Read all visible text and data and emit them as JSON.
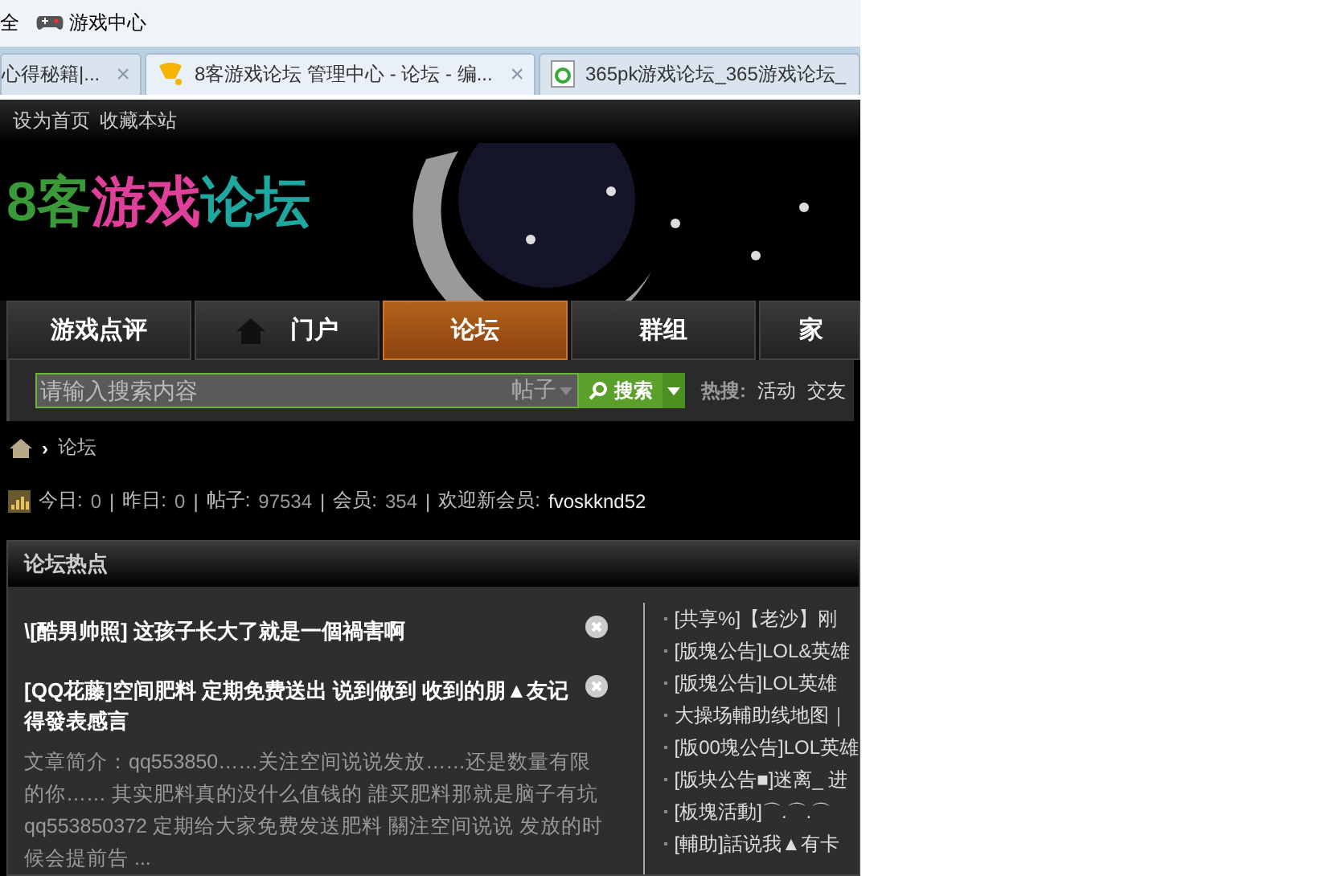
{
  "bookmarks": [
    {
      "label": "全",
      "kind": "text"
    },
    {
      "label": "游戏中心",
      "kind": "game"
    }
  ],
  "tabs": [
    {
      "label": "心得秘籍|...",
      "selected": false,
      "kind": "plain",
      "close": "×"
    },
    {
      "label": "8客游戏论坛 管理中心 - 论坛 - 编...",
      "selected": true,
      "kind": "forum",
      "close": "×"
    },
    {
      "label": "365pk游戏论坛_365游戏论坛_",
      "selected": false,
      "kind": "page"
    }
  ],
  "top_links": [
    "设为首页",
    "收藏本站"
  ],
  "logo": [
    {
      "text": "8客",
      "color": "#3a9a3a"
    },
    {
      "text": "游戏",
      "color": "#e0409a"
    },
    {
      "text": "论坛",
      "color": "#1fa8a0"
    }
  ],
  "nav": [
    {
      "label": "游戏点评",
      "selected": false,
      "icon": false
    },
    {
      "label": "门户",
      "selected": false,
      "icon": true
    },
    {
      "label": "论坛",
      "selected": true,
      "icon": false
    },
    {
      "label": "群组",
      "selected": false,
      "icon": false
    },
    {
      "label": "家",
      "selected": false,
      "icon": false
    }
  ],
  "search": {
    "placeholder": "请输入搜索内容",
    "scope": "帖子",
    "button": "搜索",
    "hot_label": "热搜:",
    "hot": [
      "活动",
      "交友"
    ]
  },
  "breadcrumb": {
    "separator": "›",
    "current": "论坛"
  },
  "stats": {
    "separator": "|",
    "items": [
      {
        "label": "今日:",
        "value": "0"
      },
      {
        "label": "昨日:",
        "value": "0"
      },
      {
        "label": "帖子:",
        "value": "97534"
      },
      {
        "label": "会员:",
        "value": "354"
      },
      {
        "label": "欢迎新会员:",
        "value": "fvoskknd52",
        "kind": "user"
      }
    ]
  },
  "hot_panel": {
    "title": "论坛热点",
    "posts": [
      {
        "title": "\\[酷男帅照] 这孩子长大了就是一個禍害啊"
      },
      {
        "title": "[QQ花藤]空间肥料 定期免费送出 说到做到 收到的朋▲友记得發表感言",
        "summary": "文章简介：qq553850……关注空间说说发放……还是数量有限的你…… 其实肥料真的没什么值钱的 誰买肥料那就是脑子有坑qq553850372 定期给大家免费发送肥料 關注空间说说 发放的时候会提前告 ..."
      }
    ],
    "links": [
      "[共享%]【老沙】刚",
      "[版塊公告]LOL&英雄",
      "[版塊公告]LOL英雄",
      "大操场輔助线地图｜",
      "[版00塊公告]LOL英雄",
      "[版块公告■]迷离_ 进",
      "[板塊活動]⌒.⌒.⌒",
      "[輔助]話说我▲有卡"
    ]
  }
}
